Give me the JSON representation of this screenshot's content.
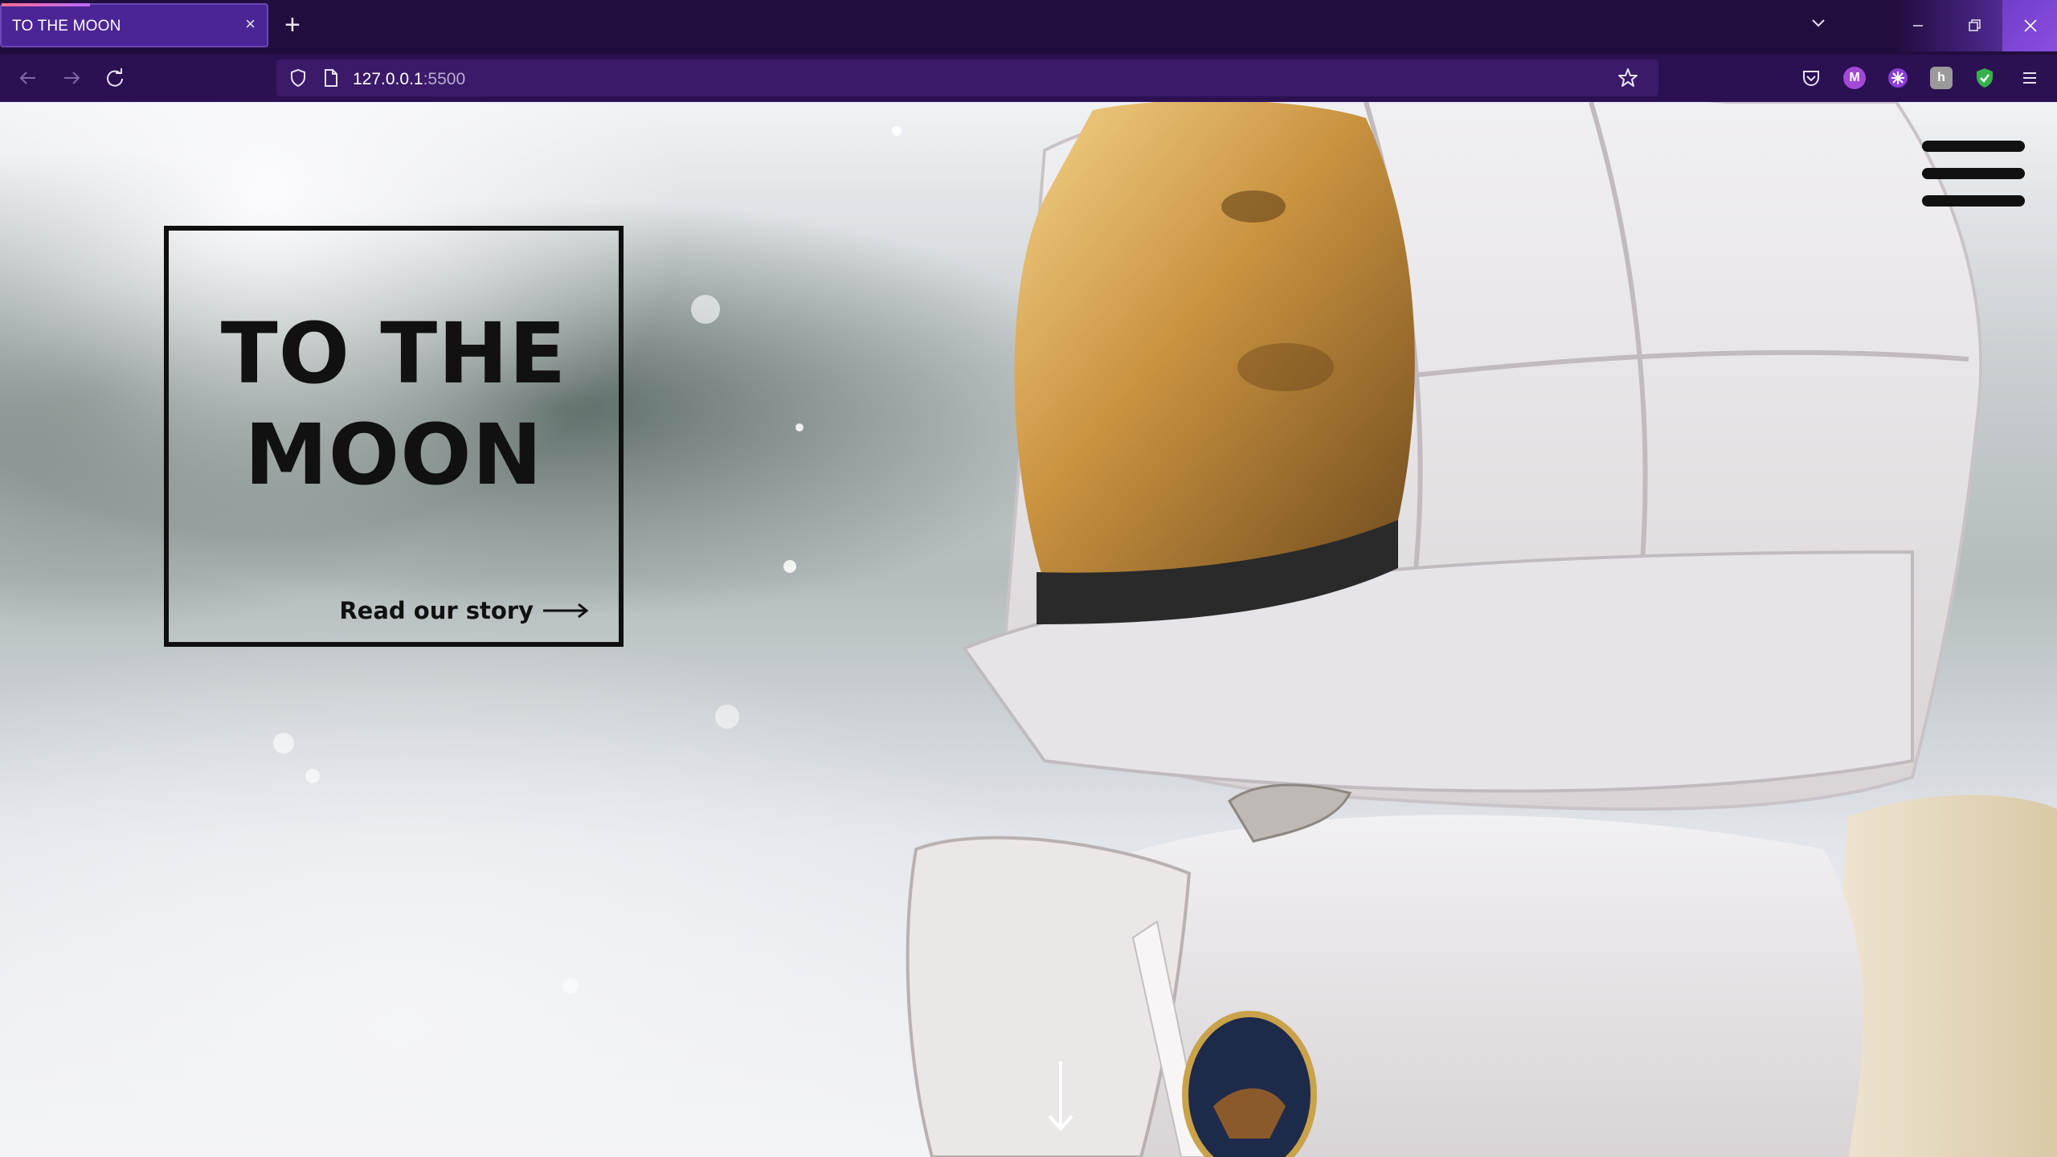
{
  "browser": {
    "tab": {
      "title": "TO THE MOON",
      "close_symbol": "×"
    },
    "new_tab_symbol": "+",
    "url": {
      "host": "127.0.0.1",
      "port": ":5500"
    },
    "icons": [
      "back-icon",
      "forward-icon",
      "reload-icon",
      "shield-icon",
      "page-icon",
      "star-icon",
      "pocket-icon",
      "extensions",
      "menu-icon"
    ],
    "extensions": [
      {
        "name": "m-extension",
        "label": "M",
        "color": "#a24ad6"
      },
      {
        "name": "puzzle-extension",
        "label": "",
        "color": "#8b3fd9"
      },
      {
        "name": "h-extension",
        "label": "h",
        "color": "#9a9a9a"
      },
      {
        "name": "shield-check-extension",
        "label": "",
        "color": "#34b34a"
      }
    ]
  },
  "page": {
    "title_line1": "TO THE",
    "title_line2": "MOON",
    "cta_label": "Read our story",
    "menu_icon": "hamburger-menu-icon",
    "scroll_icon": "arrow-down-icon",
    "colors": {
      "text": "#111111",
      "accent_purple": "#4b2595"
    }
  }
}
